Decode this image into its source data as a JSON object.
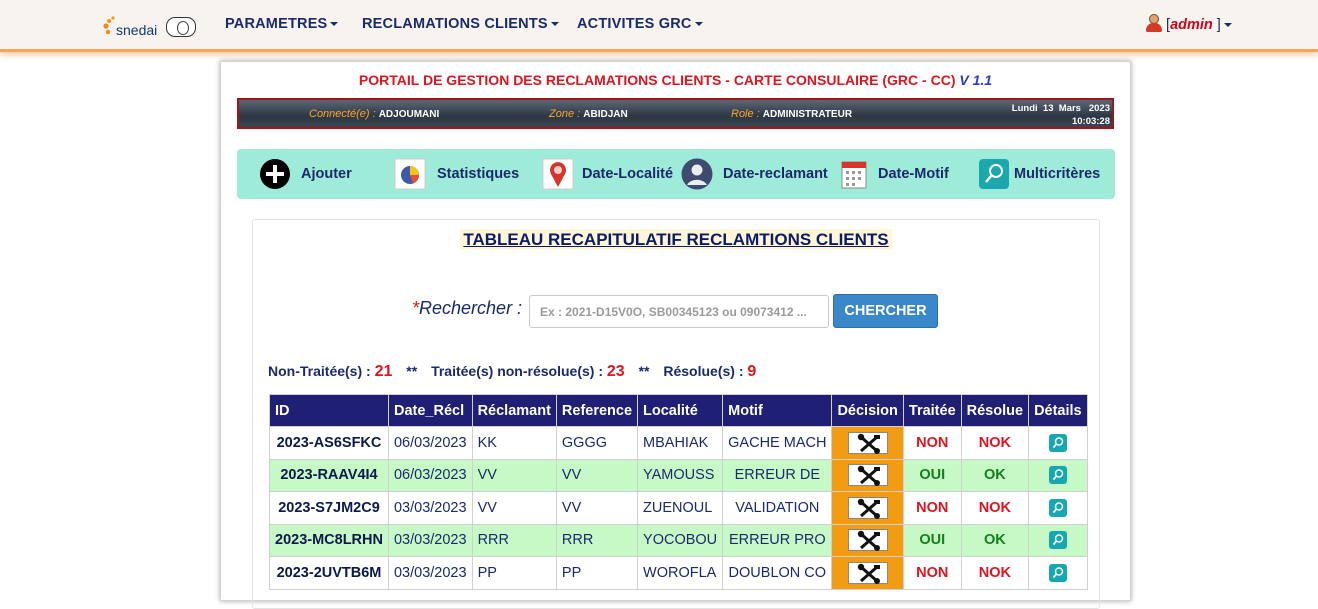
{
  "brand": {
    "name": "snedai"
  },
  "nav": {
    "items": [
      {
        "label": "PARAMETRES"
      },
      {
        "label": "RECLAMATIONS CLIENTS"
      },
      {
        "label": "ACTIVITES GRC"
      }
    ],
    "user_open": "[",
    "user_name": "admin",
    "user_close": " ]"
  },
  "portal": {
    "title": "PORTAIL DE GESTION DES RECLAMATIONS CLIENTS - CARTE CONSULAIRE (GRC - CC)",
    "version": "V 1.1"
  },
  "info": {
    "connected_label": "Connecté(e) : ",
    "connected_value": "ADJOUMANI",
    "zone_label": "Zone : ",
    "zone_value": "ABIDJAN",
    "role_label": "Role : ",
    "role_value": "ADMINISTRATEUR",
    "date": "Lundi  13  Mars   2023",
    "time": "10:03:28"
  },
  "toolbar": {
    "items": [
      {
        "label": "Ajouter",
        "icon": "plus-circle-icon"
      },
      {
        "label": "Statistiques",
        "icon": "chart-icon"
      },
      {
        "label": "Date-Localité",
        "icon": "map-pin-icon"
      },
      {
        "label": "Date-reclamant",
        "icon": "user-icon"
      },
      {
        "label": "Date-Motif",
        "icon": "calendar-icon"
      },
      {
        "label": "Multicritères",
        "icon": "search-icon"
      }
    ]
  },
  "table_title": "TABLEAU RECAPITULATIF RECLAMTIONS CLIENTS",
  "search": {
    "label": "Rechercher :",
    "star": "*",
    "placeholder": "Ex : 2021-D15V0O, SB00345123 ou 09073412 ...",
    "value": "",
    "button": "CHERCHER"
  },
  "stats": {
    "non_traitees_label": "Non-Traitée(s) : ",
    "non_traitees": "21",
    "separator": "**",
    "traitees_label": "Traitée(s) non-résolue(s) : ",
    "traitees": "23",
    "resolues_label": "Résolue(s) : ",
    "resolues": "9"
  },
  "table": {
    "headers": [
      "ID",
      "Date_Récl",
      "Réclamant",
      "Reference",
      "Localité",
      "Motif",
      "Décision",
      "Traitée",
      "Résolue",
      "Détails"
    ],
    "rows": [
      {
        "id": "2023-AS6SFKC",
        "date": "06/03/2023",
        "reclamant": "KK",
        "reference": "GGGG",
        "localite": "MBAHIAK",
        "motif": "GACHE MACH",
        "traitee": "NON",
        "resolue": "NOK"
      },
      {
        "id": "2023-RAAV4I4",
        "date": "06/03/2023",
        "reclamant": "VV",
        "reference": "VV",
        "localite": "YAMOUSS",
        "motif": "ERREUR DE",
        "traitee": "OUI",
        "resolue": "OK"
      },
      {
        "id": "2023-S7JM2C9",
        "date": "03/03/2023",
        "reclamant": "VV",
        "reference": "VV",
        "localite": "ZUENOUL",
        "motif": "VALIDATION",
        "traitee": "NON",
        "resolue": "NOK"
      },
      {
        "id": "2023-MC8LRHN",
        "date": "03/03/2023",
        "reclamant": "RRR",
        "reference": "RRR",
        "localite": "YOCOBOU",
        "motif": "ERREUR PRO",
        "traitee": "OUI",
        "resolue": "OK"
      },
      {
        "id": "2023-2UVTB6M",
        "date": "03/03/2023",
        "reclamant": "PP",
        "reference": "PP",
        "localite": "WOROFLA",
        "motif": "DOUBLON CO",
        "traitee": "NON",
        "resolue": "NOK"
      }
    ]
  },
  "colors": {
    "nav_text": "#1b2a6b",
    "accent_red": "#e0141e",
    "decision_orange": "#f39c12",
    "row_green": "#c7f9c6",
    "header_navy": "#1f1f75",
    "toolbar_teal": "#9eebd9"
  }
}
